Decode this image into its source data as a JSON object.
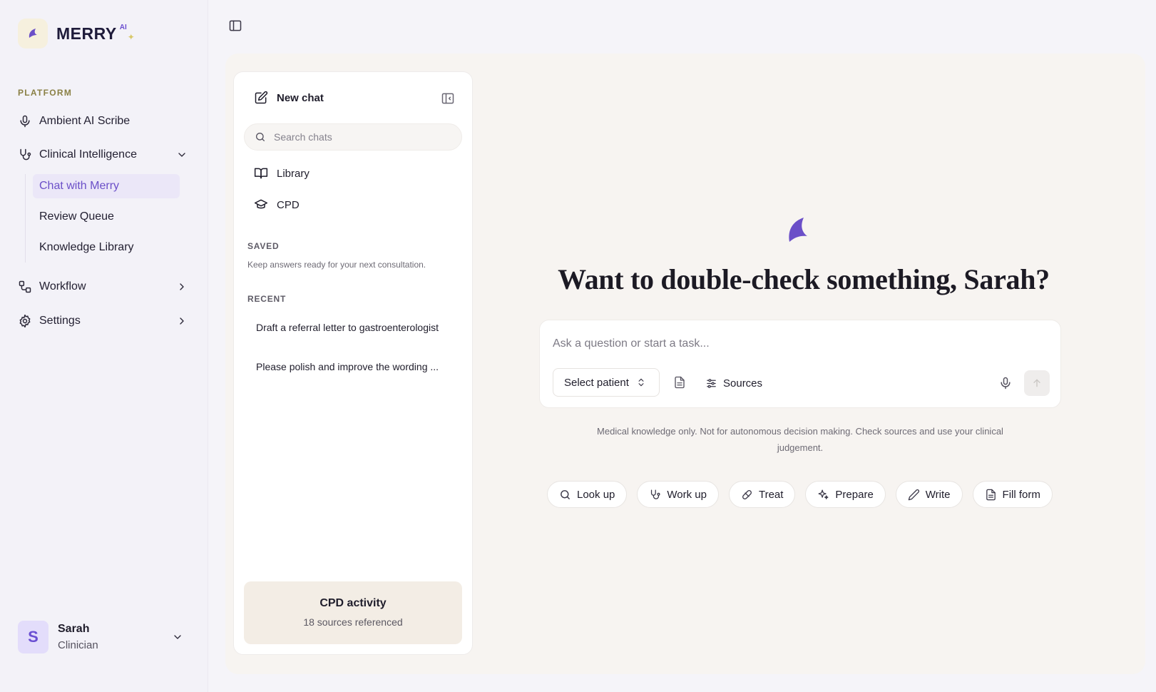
{
  "brand": {
    "name": "MERRY",
    "badge": "AI",
    "spark": "✦"
  },
  "sidebar": {
    "section_label": "PLATFORM",
    "items": [
      {
        "label": "Ambient AI Scribe",
        "icon": "microphone-icon"
      },
      {
        "label": "Clinical Intelligence",
        "icon": "stethoscope-icon",
        "expanded": true,
        "children": [
          {
            "label": "Chat with Merry",
            "active": true
          },
          {
            "label": "Review Queue"
          },
          {
            "label": "Knowledge Library"
          }
        ]
      },
      {
        "label": "Workflow",
        "icon": "workflow-icon"
      },
      {
        "label": "Settings",
        "icon": "gear-icon"
      }
    ]
  },
  "user": {
    "initial": "S",
    "name": "Sarah",
    "role": "Clinician"
  },
  "chat_panel": {
    "new_chat_label": "New chat",
    "search_placeholder": "Search chats",
    "links": [
      {
        "label": "Library",
        "icon": "book-icon"
      },
      {
        "label": "CPD",
        "icon": "graduation-cap-icon"
      }
    ],
    "saved_heading": "SAVED",
    "saved_note": "Keep answers ready for your next consultation.",
    "recent_heading": "RECENT",
    "recent": [
      "Draft a referral letter to gastroenterologist",
      "Please polish and improve the wording ..."
    ],
    "cpd_card": {
      "title": "CPD activity",
      "subtitle": "18 sources referenced"
    }
  },
  "main": {
    "greeting": "Want to double-check something, Sarah?",
    "composer": {
      "placeholder": "Ask a question or start a task...",
      "select_patient_label": "Select patient",
      "sources_label": "Sources"
    },
    "disclaimer": "Medical knowledge only. Not for autonomous decision making. Check sources and use your clinical judgement.",
    "actions": [
      {
        "label": "Look up",
        "icon": "search-icon"
      },
      {
        "label": "Work up",
        "icon": "stethoscope-icon"
      },
      {
        "label": "Treat",
        "icon": "pill-icon"
      },
      {
        "label": "Prepare",
        "icon": "sparkle-icon"
      },
      {
        "label": "Write",
        "icon": "pencil-icon"
      },
      {
        "label": "Fill form",
        "icon": "document-icon"
      }
    ]
  },
  "colors": {
    "accent": "#6b4fc8",
    "active_bg": "#ebe7f8",
    "brand_logo_bg": "#f6f0de",
    "section_label": "#8a8045",
    "cpd_card_bg": "#f3ede5"
  }
}
